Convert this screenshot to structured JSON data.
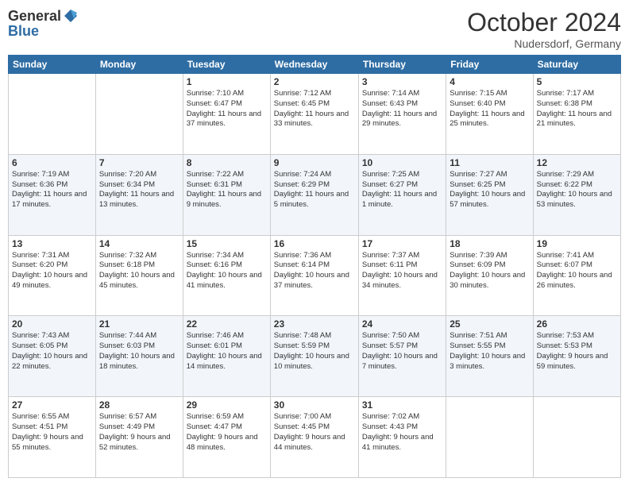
{
  "header": {
    "logo_general": "General",
    "logo_blue": "Blue",
    "month": "October 2024",
    "location": "Nudersdorf, Germany"
  },
  "days_of_week": [
    "Sunday",
    "Monday",
    "Tuesday",
    "Wednesday",
    "Thursday",
    "Friday",
    "Saturday"
  ],
  "weeks": [
    [
      {
        "day": "",
        "sunrise": "",
        "sunset": "",
        "daylight": ""
      },
      {
        "day": "",
        "sunrise": "",
        "sunset": "",
        "daylight": ""
      },
      {
        "day": "1",
        "sunrise": "Sunrise: 7:10 AM",
        "sunset": "Sunset: 6:47 PM",
        "daylight": "Daylight: 11 hours and 37 minutes."
      },
      {
        "day": "2",
        "sunrise": "Sunrise: 7:12 AM",
        "sunset": "Sunset: 6:45 PM",
        "daylight": "Daylight: 11 hours and 33 minutes."
      },
      {
        "day": "3",
        "sunrise": "Sunrise: 7:14 AM",
        "sunset": "Sunset: 6:43 PM",
        "daylight": "Daylight: 11 hours and 29 minutes."
      },
      {
        "day": "4",
        "sunrise": "Sunrise: 7:15 AM",
        "sunset": "Sunset: 6:40 PM",
        "daylight": "Daylight: 11 hours and 25 minutes."
      },
      {
        "day": "5",
        "sunrise": "Sunrise: 7:17 AM",
        "sunset": "Sunset: 6:38 PM",
        "daylight": "Daylight: 11 hours and 21 minutes."
      }
    ],
    [
      {
        "day": "6",
        "sunrise": "Sunrise: 7:19 AM",
        "sunset": "Sunset: 6:36 PM",
        "daylight": "Daylight: 11 hours and 17 minutes."
      },
      {
        "day": "7",
        "sunrise": "Sunrise: 7:20 AM",
        "sunset": "Sunset: 6:34 PM",
        "daylight": "Daylight: 11 hours and 13 minutes."
      },
      {
        "day": "8",
        "sunrise": "Sunrise: 7:22 AM",
        "sunset": "Sunset: 6:31 PM",
        "daylight": "Daylight: 11 hours and 9 minutes."
      },
      {
        "day": "9",
        "sunrise": "Sunrise: 7:24 AM",
        "sunset": "Sunset: 6:29 PM",
        "daylight": "Daylight: 11 hours and 5 minutes."
      },
      {
        "day": "10",
        "sunrise": "Sunrise: 7:25 AM",
        "sunset": "Sunset: 6:27 PM",
        "daylight": "Daylight: 11 hours and 1 minute."
      },
      {
        "day": "11",
        "sunrise": "Sunrise: 7:27 AM",
        "sunset": "Sunset: 6:25 PM",
        "daylight": "Daylight: 10 hours and 57 minutes."
      },
      {
        "day": "12",
        "sunrise": "Sunrise: 7:29 AM",
        "sunset": "Sunset: 6:22 PM",
        "daylight": "Daylight: 10 hours and 53 minutes."
      }
    ],
    [
      {
        "day": "13",
        "sunrise": "Sunrise: 7:31 AM",
        "sunset": "Sunset: 6:20 PM",
        "daylight": "Daylight: 10 hours and 49 minutes."
      },
      {
        "day": "14",
        "sunrise": "Sunrise: 7:32 AM",
        "sunset": "Sunset: 6:18 PM",
        "daylight": "Daylight: 10 hours and 45 minutes."
      },
      {
        "day": "15",
        "sunrise": "Sunrise: 7:34 AM",
        "sunset": "Sunset: 6:16 PM",
        "daylight": "Daylight: 10 hours and 41 minutes."
      },
      {
        "day": "16",
        "sunrise": "Sunrise: 7:36 AM",
        "sunset": "Sunset: 6:14 PM",
        "daylight": "Daylight: 10 hours and 37 minutes."
      },
      {
        "day": "17",
        "sunrise": "Sunrise: 7:37 AM",
        "sunset": "Sunset: 6:11 PM",
        "daylight": "Daylight: 10 hours and 34 minutes."
      },
      {
        "day": "18",
        "sunrise": "Sunrise: 7:39 AM",
        "sunset": "Sunset: 6:09 PM",
        "daylight": "Daylight: 10 hours and 30 minutes."
      },
      {
        "day": "19",
        "sunrise": "Sunrise: 7:41 AM",
        "sunset": "Sunset: 6:07 PM",
        "daylight": "Daylight: 10 hours and 26 minutes."
      }
    ],
    [
      {
        "day": "20",
        "sunrise": "Sunrise: 7:43 AM",
        "sunset": "Sunset: 6:05 PM",
        "daylight": "Daylight: 10 hours and 22 minutes."
      },
      {
        "day": "21",
        "sunrise": "Sunrise: 7:44 AM",
        "sunset": "Sunset: 6:03 PM",
        "daylight": "Daylight: 10 hours and 18 minutes."
      },
      {
        "day": "22",
        "sunrise": "Sunrise: 7:46 AM",
        "sunset": "Sunset: 6:01 PM",
        "daylight": "Daylight: 10 hours and 14 minutes."
      },
      {
        "day": "23",
        "sunrise": "Sunrise: 7:48 AM",
        "sunset": "Sunset: 5:59 PM",
        "daylight": "Daylight: 10 hours and 10 minutes."
      },
      {
        "day": "24",
        "sunrise": "Sunrise: 7:50 AM",
        "sunset": "Sunset: 5:57 PM",
        "daylight": "Daylight: 10 hours and 7 minutes."
      },
      {
        "day": "25",
        "sunrise": "Sunrise: 7:51 AM",
        "sunset": "Sunset: 5:55 PM",
        "daylight": "Daylight: 10 hours and 3 minutes."
      },
      {
        "day": "26",
        "sunrise": "Sunrise: 7:53 AM",
        "sunset": "Sunset: 5:53 PM",
        "daylight": "Daylight: 9 hours and 59 minutes."
      }
    ],
    [
      {
        "day": "27",
        "sunrise": "Sunrise: 6:55 AM",
        "sunset": "Sunset: 4:51 PM",
        "daylight": "Daylight: 9 hours and 55 minutes."
      },
      {
        "day": "28",
        "sunrise": "Sunrise: 6:57 AM",
        "sunset": "Sunset: 4:49 PM",
        "daylight": "Daylight: 9 hours and 52 minutes."
      },
      {
        "day": "29",
        "sunrise": "Sunrise: 6:59 AM",
        "sunset": "Sunset: 4:47 PM",
        "daylight": "Daylight: 9 hours and 48 minutes."
      },
      {
        "day": "30",
        "sunrise": "Sunrise: 7:00 AM",
        "sunset": "Sunset: 4:45 PM",
        "daylight": "Daylight: 9 hours and 44 minutes."
      },
      {
        "day": "31",
        "sunrise": "Sunrise: 7:02 AM",
        "sunset": "Sunset: 4:43 PM",
        "daylight": "Daylight: 9 hours and 41 minutes."
      },
      {
        "day": "",
        "sunrise": "",
        "sunset": "",
        "daylight": ""
      },
      {
        "day": "",
        "sunrise": "",
        "sunset": "",
        "daylight": ""
      }
    ]
  ]
}
